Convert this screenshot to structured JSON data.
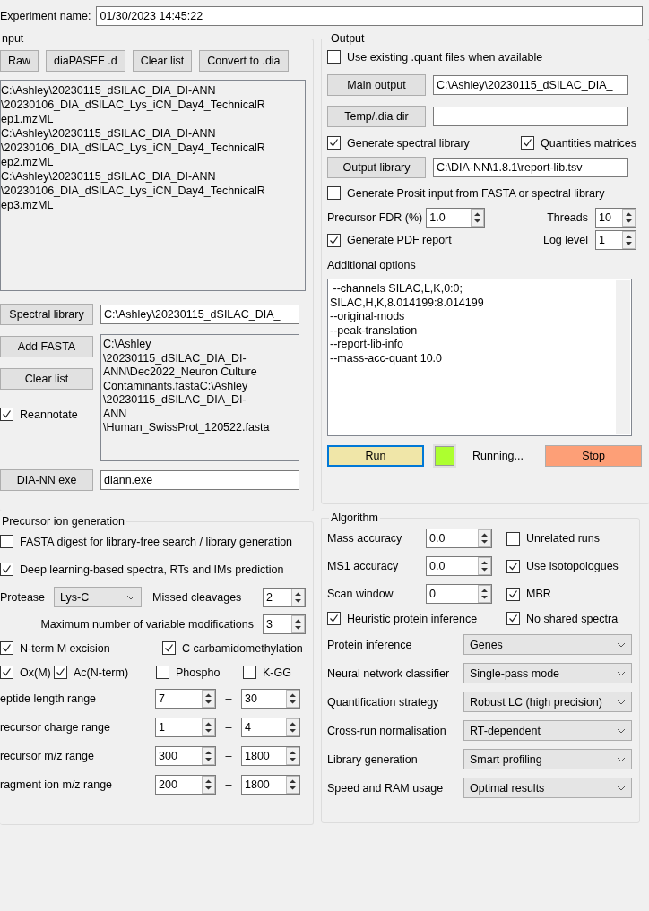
{
  "experiment": {
    "label": "Experiment name:",
    "value": "01/30/2023 14:45:22"
  },
  "input": {
    "title": "nput",
    "buttons": [
      "Raw",
      "diaPASEF .d",
      "Clear list",
      "Convert to .dia"
    ],
    "files": [
      "C:\\Ashley\\20230115_dSILAC_DIA_DI-ANN",
      "\\20230106_DIA_dSILAC_Lys_iCN_Day4_TechnicalR",
      "ep1.mzML",
      "C:\\Ashley\\20230115_dSILAC_DIA_DI-ANN",
      "\\20230106_DIA_dSILAC_Lys_iCN_Day4_TechnicalR",
      "ep2.mzML",
      "C:\\Ashley\\20230115_dSILAC_DIA_DI-ANN",
      "\\20230106_DIA_dSILAC_Lys_iCN_Day4_TechnicalR",
      "ep3.mzML"
    ],
    "spectral_library": {
      "button": "Spectral library",
      "value": "C:\\Ashley\\20230115_dSILAC_DIA_"
    },
    "add_fasta": "Add FASTA",
    "clear_fasta": "Clear list",
    "reannotate": {
      "label": "Reannotate",
      "checked": true
    },
    "fasta_lines": [
      "C:\\Ashley",
      "\\20230115_dSILAC_DIA_DI-",
      "ANN\\Dec2022_Neuron Culture",
      "Contaminants.fastaC:\\Ashley",
      "\\20230115_dSILAC_DIA_DI-",
      "ANN",
      "\\Human_SwissProt_120522.fasta"
    ],
    "exe": {
      "button": "DIA-NN exe",
      "value": "diann.exe"
    }
  },
  "output": {
    "title": "Output",
    "use_existing": {
      "label": "Use existing .quant files when available",
      "checked": false
    },
    "main_output": {
      "button": "Main output",
      "value": "C:\\Ashley\\20230115_dSILAC_DIA_"
    },
    "temp_dir": {
      "button": "Temp/.dia dir"
    },
    "gen_library": {
      "label": "Generate spectral library",
      "checked": true
    },
    "quantities": {
      "label": "Quantities matrices",
      "checked": true
    },
    "output_library": {
      "button": "Output library",
      "value": "C:\\DIA-NN\\1.8.1\\report-lib.tsv"
    },
    "prosit": {
      "label": "Generate Prosit input from FASTA or spectral library",
      "checked": false
    },
    "fdr": {
      "label": "Precursor FDR (%)",
      "value": "1.0"
    },
    "threads": {
      "label": "Threads",
      "value": "10"
    },
    "pdf": {
      "label": "Generate PDF report",
      "checked": true
    },
    "log_level": {
      "label": "Log level",
      "value": "1"
    },
    "additional_label": "Additional options",
    "additional_lines": [
      " --channels SILAC,L,K,0:0;",
      "SILAC,H,K,8.014199:8.014199",
      "--original-mods",
      "--peak-translation",
      "--report-lib-info",
      "--mass-acc-quant 10.0"
    ],
    "run": "Run",
    "status": "Running...",
    "stop": "Stop"
  },
  "precursor": {
    "title": "Precursor ion generation",
    "fasta_digest": {
      "label": "FASTA digest for library-free search / library generation",
      "checked": false
    },
    "deep_learning": {
      "label": "Deep learning-based spectra, RTs and IMs prediction",
      "checked": true
    },
    "protease": {
      "label": "Protease",
      "value": "Lys-C"
    },
    "missed": {
      "label": "Missed cleavages",
      "value": "2"
    },
    "max_mods": {
      "label": "Maximum number of variable modifications",
      "value": "3"
    },
    "nterm": {
      "label": "N-term M excision",
      "checked": true
    },
    "carb": {
      "label": "C carbamidomethylation",
      "checked": true
    },
    "mods": [
      {
        "label": "Ox(M)",
        "checked": true
      },
      {
        "label": "Ac(N-term)",
        "checked": true
      },
      {
        "label": "Phospho",
        "checked": false
      },
      {
        "label": "K-GG",
        "checked": false
      }
    ],
    "ranges": [
      {
        "label": "eptide length range",
        "from": "7",
        "separator": "–",
        "to": "30"
      },
      {
        "label": "recursor charge range",
        "from": "1",
        "separator": "–",
        "to": "4"
      },
      {
        "label": "recursor m/z range",
        "from": "300",
        "separator": "–",
        "to": "1800"
      },
      {
        "label": "ragment ion m/z range",
        "from": "200",
        "separator": "–",
        "to": "1800"
      }
    ]
  },
  "algorithm": {
    "title": "Algorithm",
    "spins": [
      {
        "label": "Mass accuracy",
        "value": "0.0",
        "option": {
          "label": "Unrelated runs",
          "checked": false
        }
      },
      {
        "label": "MS1 accuracy",
        "value": "0.0",
        "option": {
          "label": "Use isotopologues",
          "checked": true
        }
      },
      {
        "label": "Scan window",
        "value": "0",
        "option": {
          "label": "MBR",
          "checked": true
        }
      }
    ],
    "heuristic": {
      "label": "Heuristic protein inference",
      "checked": true
    },
    "no_shared": {
      "label": "No shared spectra",
      "checked": true
    },
    "selects": [
      {
        "label": "Protein inference",
        "value": "Genes"
      },
      {
        "label": "Neural network classifier",
        "value": "Single-pass mode"
      },
      {
        "label": "Quantification strategy",
        "value": "Robust LC (high precision)"
      },
      {
        "label": "Cross-run normalisation",
        "value": "RT-dependent"
      },
      {
        "label": "Library generation",
        "value": "Smart profiling"
      },
      {
        "label": "Speed and RAM usage",
        "value": "Optimal results"
      }
    ]
  }
}
